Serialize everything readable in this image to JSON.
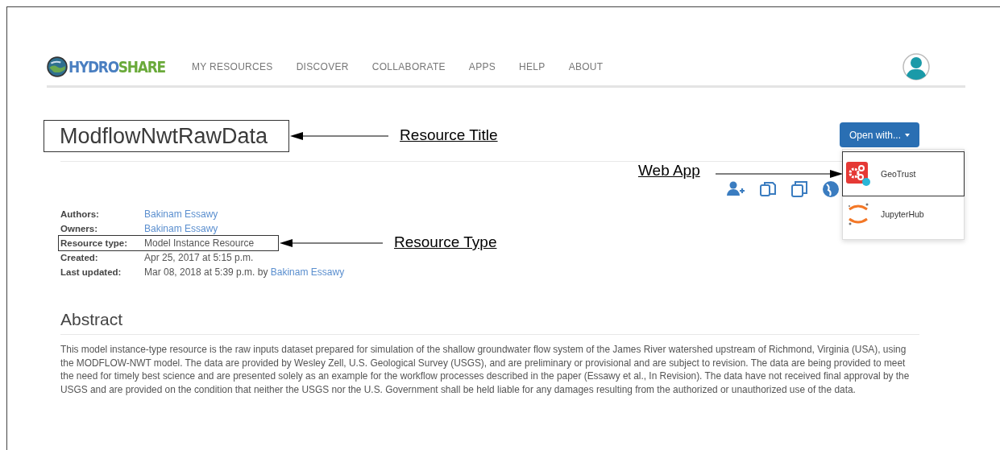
{
  "nav": {
    "logo": {
      "part_1": "HYDRO",
      "part_2": "SHARE"
    },
    "items": [
      {
        "label": "MY RESOURCES"
      },
      {
        "label": "DISCOVER"
      },
      {
        "label": "COLLABORATE"
      },
      {
        "label": "APPS"
      },
      {
        "label": "HELP"
      },
      {
        "label": "ABOUT"
      }
    ]
  },
  "resource": {
    "title": "ModflowNwtRawData"
  },
  "open_with": {
    "button": "Open with...",
    "expanded": true,
    "apps": [
      {
        "name": "GeoTrust",
        "kind": "geotrust"
      },
      {
        "name": "JupyterHub",
        "kind": "jupyter"
      }
    ]
  },
  "metadata": [
    {
      "label": "Authors:",
      "kind": "link",
      "value": "Bakinam Essawy"
    },
    {
      "label": "Owners:",
      "kind": "link",
      "value": "Bakinam Essawy"
    },
    {
      "label": "Resource type:",
      "kind": "text",
      "value": "Model Instance Resource"
    },
    {
      "label": "Created:",
      "kind": "text",
      "value": "Apr 25, 2017 at 5:15 p.m."
    },
    {
      "label": "Last updated:",
      "kind": "text_link",
      "value": "Mar 08, 2018 at 5:39 p.m. by",
      "link": "Bakinam Essawy"
    }
  ],
  "abstract": {
    "heading": "Abstract",
    "text": "This model instance-type resource is the raw inputs dataset prepared for simulation of the shallow groundwater flow system of the James River watershed upstream of Richmond, Virginia (USA), using the MODFLOW-NWT model. The data are provided by Wesley Zell, U.S. Geological Survey (USGS), and are preliminary or provisional and are subject to revision. The data are being provided to meet the need for timely best science and are presented solely as an example for the workflow processes described in the paper (Essawy et al., In Revision). The data have not received final approval by the USGS and are provided on the condition that neither the USGS nor the U.S. Government shall be held liable for any damages resulting from the authorized or unauthorized use of the data."
  },
  "annotations": [
    {
      "label": "Resource Title",
      "kind": "title"
    },
    {
      "label": "Resource Type",
      "kind": "type"
    },
    {
      "label": "Web App",
      "kind": "app"
    }
  ]
}
